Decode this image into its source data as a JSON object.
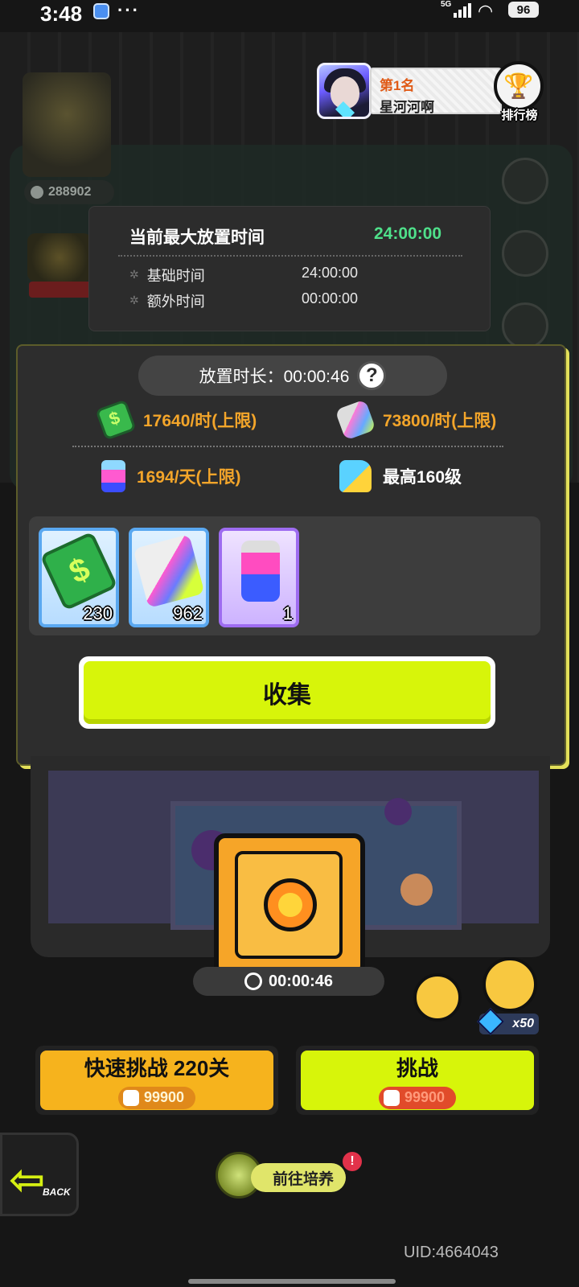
{
  "status_bar": {
    "time": "3:48",
    "network": "5G",
    "more": "···",
    "battery": "96"
  },
  "ranking": {
    "rank_label": "第1名",
    "player_name": "星河河啊",
    "button_label": "排行榜"
  },
  "background": {
    "score": "288902"
  },
  "idle_tooltip": {
    "title": "当前最大放置时间",
    "max_time": "24:00:00",
    "rows": [
      {
        "label": "基础时间",
        "value": "24:00:00"
      },
      {
        "label": "额外时间",
        "value": "00:00:00"
      }
    ]
  },
  "reward_dialog": {
    "duration_label": "放置时长：00:00:46",
    "help": "?",
    "rates": {
      "cash_rate": "17640/时(上限)",
      "paint_rate": "73800/时(上限)",
      "spray_rate": "1694/天(上限)",
      "level_cap": "最高160级"
    },
    "items": [
      {
        "name": "cash",
        "count": "230"
      },
      {
        "name": "paint",
        "count": "962"
      },
      {
        "name": "spray",
        "count": "1"
      }
    ],
    "collect_label": "收集"
  },
  "idle_chest": {
    "timer": "00:00:46"
  },
  "boost": {
    "gem_cost": "x50"
  },
  "actions": {
    "quick_challenge_label": "快速挑战 220关",
    "quick_challenge_cost": "99900",
    "challenge_label": "挑战",
    "challenge_cost": "99900",
    "back_label": "BACK",
    "cultivate_label": "前往培养",
    "cultivate_badge": "!"
  },
  "footer": {
    "uid": "UID:4664043"
  },
  "colors": {
    "accent_yellow": "#d7f50a",
    "reward_orange": "#f3a52a",
    "time_green": "#4fe08a",
    "cost_red": "#e14b2a"
  }
}
